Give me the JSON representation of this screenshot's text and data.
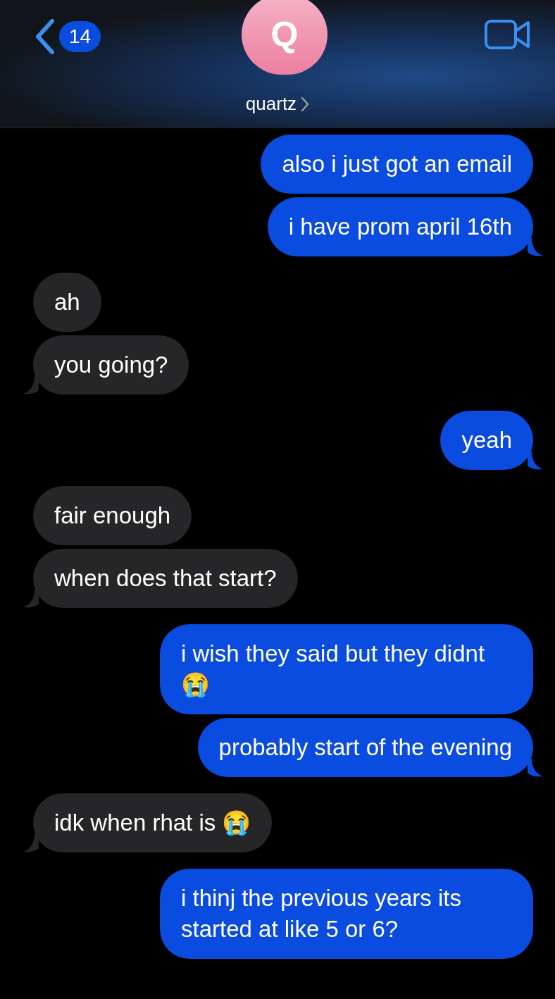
{
  "header": {
    "unread_count": "14",
    "avatar_initial": "Q",
    "contact_name": "quartz"
  },
  "messages": [
    {
      "kind": "sent",
      "text": "also i just got an email",
      "tail": false
    },
    {
      "kind": "sent",
      "text": "i have prom april 16th",
      "tail": true
    },
    {
      "kind": "received",
      "text": "ah",
      "tail": false
    },
    {
      "kind": "received",
      "text": "you going?",
      "tail": true
    },
    {
      "kind": "sent",
      "text": "yeah",
      "tail": true
    },
    {
      "kind": "received",
      "text": "fair enough",
      "tail": false
    },
    {
      "kind": "received",
      "text": "when does that start?",
      "tail": true
    },
    {
      "kind": "sent",
      "text": "i wish they said but they didnt😭",
      "tail": false
    },
    {
      "kind": "sent",
      "text": "probably start of the evening",
      "tail": true
    },
    {
      "kind": "received",
      "text": "idk when rhat is 😭",
      "tail": true
    },
    {
      "kind": "sent",
      "text": "i thinj the previous years its started at like 5 or 6?",
      "tail": false
    }
  ]
}
